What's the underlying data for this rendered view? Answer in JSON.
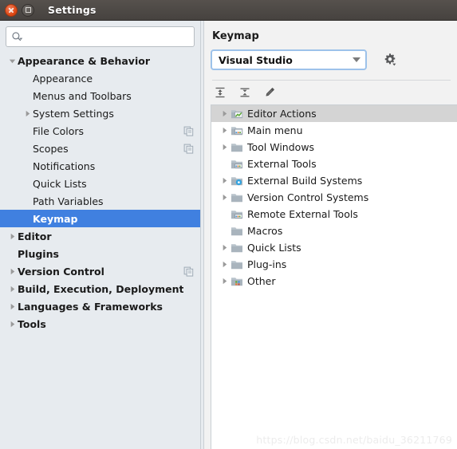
{
  "window": {
    "title": "Settings",
    "close_label": "Close",
    "maximize_label": "Maximize"
  },
  "colors": {
    "titlebar": "#46423f",
    "sidebar_bg": "#e7ebef",
    "selection_blue": "#4080e0",
    "selection_gray": "#d4d4d4",
    "focus_border": "#9dc2ea",
    "panel_bg": "#f2f2f2",
    "tree_bg": "#ffffff",
    "watermark": "#ececec"
  },
  "search": {
    "value": "",
    "placeholder": "",
    "icon": "search-icon"
  },
  "sidebar": {
    "items": [
      {
        "label": "Appearance & Behavior",
        "level": 0,
        "bold": true,
        "arrow": "down",
        "selected": false,
        "copy": false
      },
      {
        "label": "Appearance",
        "level": 1,
        "bold": false,
        "arrow": "none",
        "selected": false,
        "copy": false
      },
      {
        "label": "Menus and Toolbars",
        "level": 1,
        "bold": false,
        "arrow": "none",
        "selected": false,
        "copy": false
      },
      {
        "label": "System Settings",
        "level": 1,
        "bold": false,
        "arrow": "right",
        "selected": false,
        "copy": false
      },
      {
        "label": "File Colors",
        "level": 1,
        "bold": false,
        "arrow": "none",
        "selected": false,
        "copy": true
      },
      {
        "label": "Scopes",
        "level": 1,
        "bold": false,
        "arrow": "none",
        "selected": false,
        "copy": true
      },
      {
        "label": "Notifications",
        "level": 1,
        "bold": false,
        "arrow": "none",
        "selected": false,
        "copy": false
      },
      {
        "label": "Quick Lists",
        "level": 1,
        "bold": false,
        "arrow": "none",
        "selected": false,
        "copy": false
      },
      {
        "label": "Path Variables",
        "level": 1,
        "bold": false,
        "arrow": "none",
        "selected": false,
        "copy": false
      },
      {
        "label": "Keymap",
        "level": 1,
        "bold": true,
        "arrow": "none",
        "selected": true,
        "copy": false
      },
      {
        "label": "Editor",
        "level": 0,
        "bold": true,
        "arrow": "right",
        "selected": false,
        "copy": false
      },
      {
        "label": "Plugins",
        "level": 0,
        "bold": true,
        "arrow": "none",
        "selected": false,
        "copy": false
      },
      {
        "label": "Version Control",
        "level": 0,
        "bold": true,
        "arrow": "right",
        "selected": false,
        "copy": true
      },
      {
        "label": "Build, Execution, Deployment",
        "level": 0,
        "bold": true,
        "arrow": "right",
        "selected": false,
        "copy": false
      },
      {
        "label": "Languages & Frameworks",
        "level": 0,
        "bold": true,
        "arrow": "right",
        "selected": false,
        "copy": false
      },
      {
        "label": "Tools",
        "level": 0,
        "bold": true,
        "arrow": "right",
        "selected": false,
        "copy": false
      }
    ]
  },
  "panel": {
    "title": "Keymap",
    "keymap_select": {
      "value": "Visual Studio",
      "options": [
        "Visual Studio"
      ]
    },
    "gear_button": {
      "name": "gear-icon",
      "tooltip": "Show Scheme Actions"
    },
    "toolbar": [
      {
        "name": "expand-all-icon",
        "tooltip": "Expand All"
      },
      {
        "name": "collapse-all-icon",
        "tooltip": "Collapse All"
      },
      {
        "name": "edit-shortcut-icon",
        "tooltip": "Edit Shortcut"
      }
    ],
    "action_tree": [
      {
        "label": "Editor Actions",
        "arrow": "right",
        "icon": "folder-editor-icon",
        "selected": true
      },
      {
        "label": "Main menu",
        "arrow": "right",
        "icon": "folder-menu-icon",
        "selected": false
      },
      {
        "label": "Tool Windows",
        "arrow": "right",
        "icon": "folder-icon",
        "selected": false
      },
      {
        "label": "External Tools",
        "arrow": "none",
        "icon": "folder-tools-icon",
        "selected": false
      },
      {
        "label": "External Build Systems",
        "arrow": "right",
        "icon": "folder-build-icon",
        "selected": false
      },
      {
        "label": "Version Control Systems",
        "arrow": "right",
        "icon": "folder-icon",
        "selected": false
      },
      {
        "label": "Remote External Tools",
        "arrow": "none",
        "icon": "folder-tools-icon",
        "selected": false
      },
      {
        "label": "Macros",
        "arrow": "none",
        "icon": "folder-icon",
        "selected": false
      },
      {
        "label": "Quick Lists",
        "arrow": "right",
        "icon": "folder-icon",
        "selected": false
      },
      {
        "label": "Plug-ins",
        "arrow": "right",
        "icon": "folder-icon",
        "selected": false
      },
      {
        "label": "Other",
        "arrow": "right",
        "icon": "folder-other-icon",
        "selected": false
      }
    ]
  },
  "watermark": {
    "text": "https://blog.csdn.net/baidu_36211769"
  }
}
